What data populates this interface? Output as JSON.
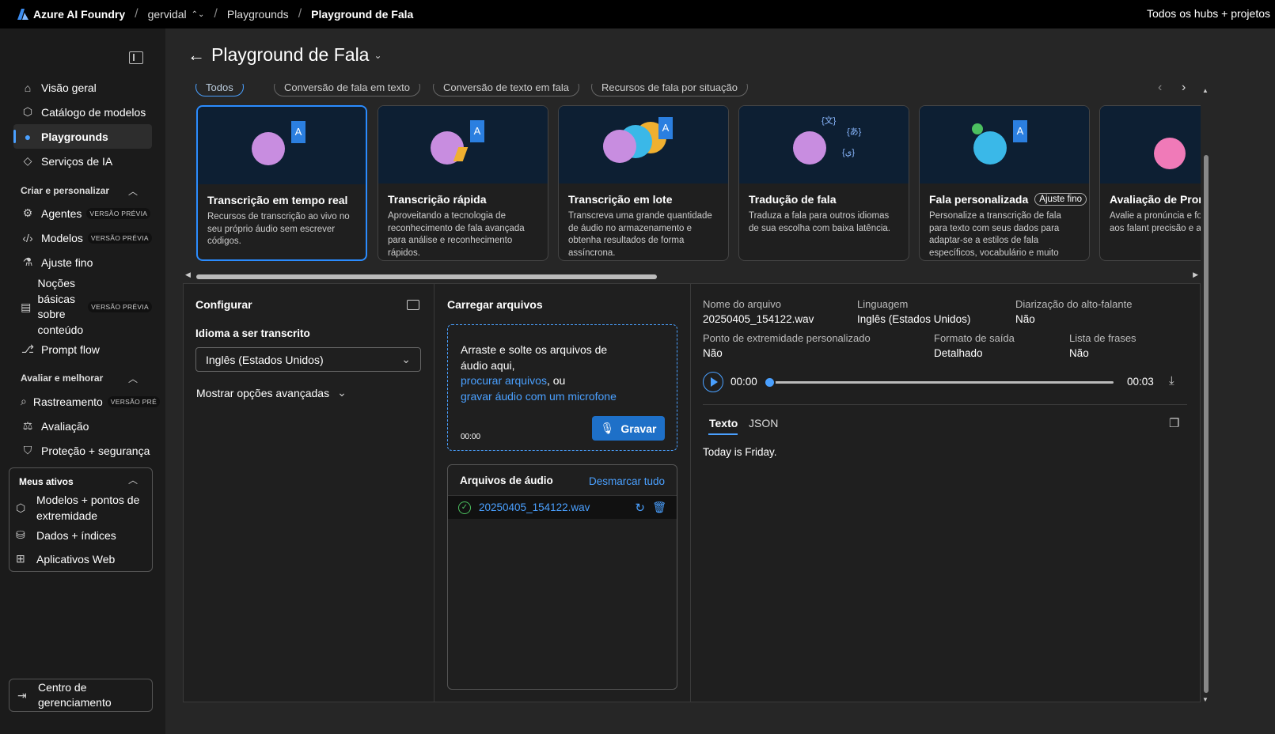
{
  "topbar": {
    "brand": "Azure AI Foundry",
    "crumbs": [
      "gervidal",
      "Playgrounds",
      "Playground de Fala"
    ],
    "hubs": "Todos os hubs + projetos"
  },
  "sidebar": {
    "items": {
      "visao": "Visão geral",
      "catalogo": "Catálogo de modelos",
      "playgrounds": "Playgrounds",
      "servicos": "Serviços de IA",
      "agentes": "Agentes",
      "modelos": "Modelos",
      "ajuste": "Ajuste fino",
      "nocoes": "Noções básicas sobre conteúdo",
      "prompt": "Prompt flow",
      "rastreamento": "Rastreamento",
      "avaliacao": "Avaliação",
      "protecao": "Proteção + segurança",
      "modelos_pontos": "Modelos + pontos de extremidade",
      "dados": "Dados + índices",
      "apps": "Aplicativos Web",
      "mgmt": "Centro de gerenciamento"
    },
    "sections": {
      "criar": "Criar e personalizar",
      "avaliar": "Avaliar e melhorar",
      "ativos": "Meus ativos"
    },
    "badge_preview": "VERSÃO PRÉVIA",
    "badge_preview_trunc": "VERSÃO PRÉ"
  },
  "main": {
    "title": "Playground de Fala",
    "pills": [
      "Todos",
      "Conversão de fala em texto",
      "Conversão de texto em fala",
      "Recursos de fala por situação"
    ],
    "cards": [
      {
        "title": "Transcrição em tempo real",
        "desc": "Recursos de transcrição ao vivo no seu próprio áudio sem escrever códigos."
      },
      {
        "title": "Transcrição rápida",
        "desc": "Aproveitando a tecnologia de reconhecimento de fala avançada para análise e reconhecimento rápidos."
      },
      {
        "title": "Transcrição em lote",
        "desc": "Transcreva uma grande quantidade de áudio no armazenamento e obtenha resultados de forma assíncrona."
      },
      {
        "title": "Tradução de fala",
        "desc": "Traduza a fala para outros idiomas de sua escolha com baixa latência."
      },
      {
        "title": "Fala personalizada",
        "badge": "Ajuste fino",
        "desc": "Personalize a transcrição de fala para texto com seus dados para adaptar-se a estilos de fala específicos, vocabulário e muito mais."
      },
      {
        "title": "Avaliação de Pronú",
        "desc": "Avalie a pronúncia e fo comentários aos falant precisão e a fluência d"
      }
    ]
  },
  "config": {
    "title": "Configurar",
    "lang_label": "Idioma a ser transcrito",
    "lang_value": "Inglês (Estados Unidos)",
    "advanced": "Mostrar opções avançadas"
  },
  "upload": {
    "title": "Carregar arquivos",
    "drop_text": "Arraste e solte os arquivos de áudio aqui,",
    "browse_link": "procurar arquivos",
    "or": ", ou",
    "record_link": "gravar áudio com um microfone",
    "timer": "00:00",
    "record_btn": "Gravar",
    "files_title": "Arquivos de áudio",
    "deselect": "Desmarcar tudo",
    "file_name": "20250405_154122.wav"
  },
  "result": {
    "labels": {
      "filename": "Nome do arquivo",
      "language": "Linguagem",
      "diarization": "Diarização do alto-falante",
      "endpoint": "Ponto de extremidade personalizado",
      "format": "Formato de saída",
      "phrases": "Lista de frases"
    },
    "values": {
      "filename": "20250405_154122.wav",
      "language": "Inglês (Estados Unidos)",
      "diarization": "Não",
      "endpoint": "Não",
      "format": "Detalhado",
      "phrases": "Não"
    },
    "time_start": "00:00",
    "time_end": "00:03",
    "tabs": [
      "Texto",
      "JSON"
    ],
    "transcript": "Today is Friday."
  },
  "colors": {
    "accent": "#4aa0ff",
    "button": "#1e70c8",
    "card_image_bg": "#0d1f33"
  }
}
